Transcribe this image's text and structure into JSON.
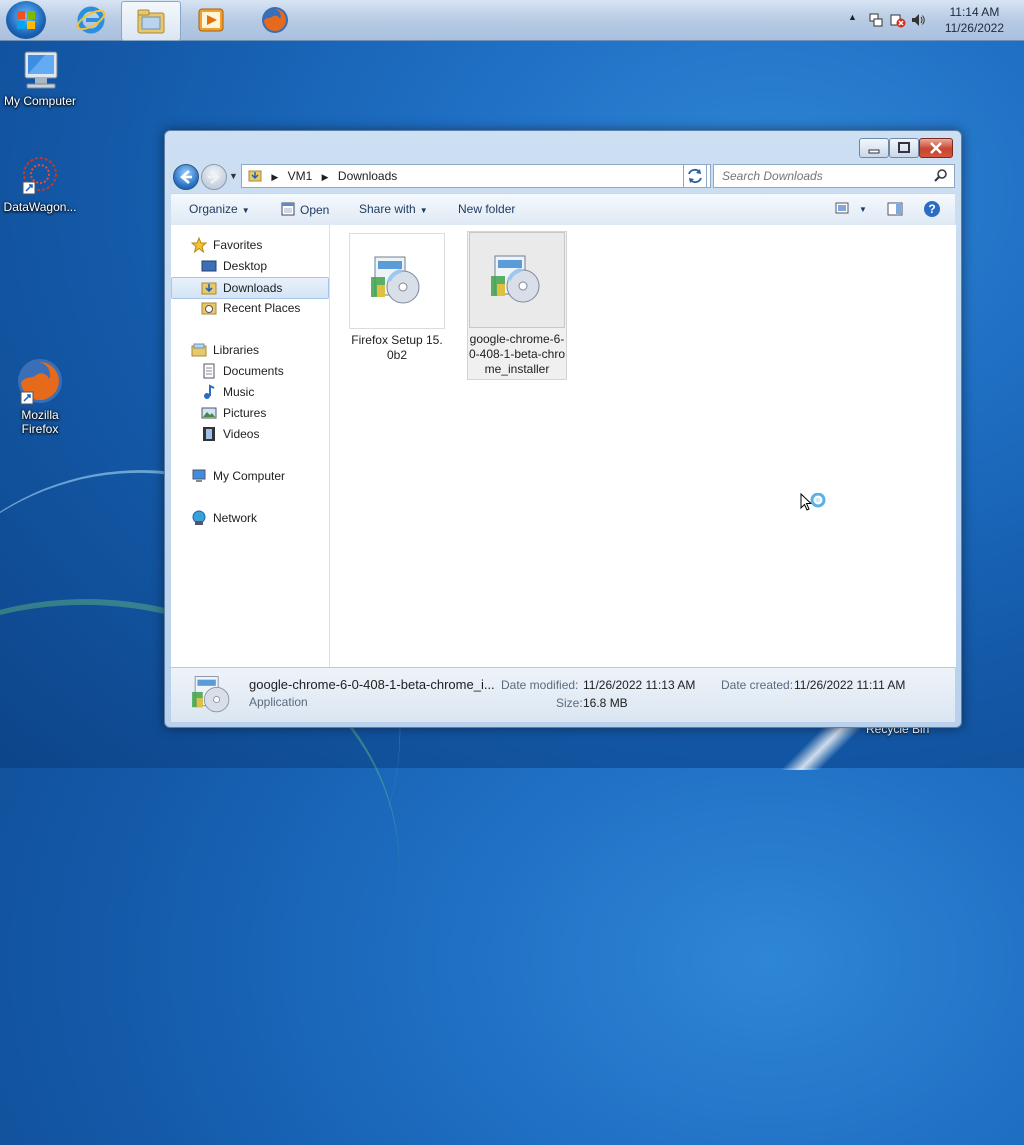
{
  "taskbar": {
    "start_icon": "windows-logo-icon",
    "pinned": [
      {
        "name": "internet-explorer-icon"
      },
      {
        "name": "windows-explorer-icon",
        "active": true
      },
      {
        "name": "media-player-icon"
      },
      {
        "name": "firefox-icon"
      }
    ],
    "clock_time": "11:14 AM",
    "clock_date": "11/26/2022",
    "tray_expand": "▲"
  },
  "desktop": {
    "icons": [
      {
        "label": "My Computer",
        "icon": "computer-icon"
      },
      {
        "label": "DataWagon...",
        "icon": "datawagon-icon"
      },
      {
        "label": "Mozilla Firefox",
        "icon": "firefox-icon"
      },
      {
        "label": "Recycle Bin",
        "icon": "recycle-bin-icon"
      }
    ]
  },
  "window": {
    "breadcrumb": [
      "VM1",
      "Downloads"
    ],
    "search_placeholder": "Search Downloads",
    "toolbar": {
      "organize": "Organize",
      "open": "Open",
      "share_with": "Share with",
      "new_folder": "New folder"
    },
    "nav": {
      "favorites": "Favorites",
      "favorites_items": [
        "Desktop",
        "Downloads",
        "Recent Places"
      ],
      "libraries": "Libraries",
      "libraries_items": [
        "Documents",
        "Music",
        "Pictures",
        "Videos"
      ],
      "computer": "My Computer",
      "network": "Network"
    },
    "files": [
      {
        "name": "Firefox Setup 15.0b2",
        "selected": false
      },
      {
        "name": "google-chrome-6-0-408-1-beta-chrome_installer",
        "selected": true
      }
    ],
    "details": {
      "name": "google-chrome-6-0-408-1-beta-chrome_i...",
      "type": "Application",
      "modified_label": "Date modified:",
      "modified_value": "11/26/2022 11:13 AM",
      "created_label": "Date created:",
      "created_value": "11/26/2022 11:11 AM",
      "size_label": "Size:",
      "size_value": "16.8 MB"
    }
  }
}
